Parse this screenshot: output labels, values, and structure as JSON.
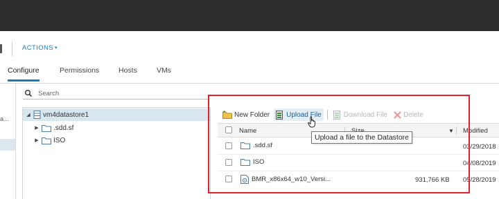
{
  "header": {
    "actions_label": "ACTIONS",
    "actions_chevron": "▾"
  },
  "tabs": [
    {
      "label": "Configure",
      "active": true
    },
    {
      "label": "Permissions",
      "active": false
    },
    {
      "label": "Hosts",
      "active": false
    },
    {
      "label": "VMs",
      "active": false
    }
  ],
  "left_pane": {
    "truncated_label": "a..."
  },
  "search": {
    "placeholder": "Search",
    "value": ""
  },
  "tree": {
    "items": [
      {
        "label": "vm4datastore1",
        "expanded": true,
        "selected": true,
        "icon": "datastore-icon"
      },
      {
        "label": ".sdd.sf",
        "expanded": false,
        "icon": "folder-icon"
      },
      {
        "label": "ISO",
        "expanded": false,
        "icon": "folder-icon"
      }
    ]
  },
  "toolbar": {
    "new_folder": "New Folder",
    "upload_file": "Upload File",
    "download_file": "Download File",
    "delete": "Delete"
  },
  "grid": {
    "columns": {
      "name": "Name",
      "size": "Size",
      "modified": "Modified"
    },
    "rows": [
      {
        "name": ".sdd.sf",
        "size": "",
        "modified": "03/29/2018",
        "icon": "folder-icon"
      },
      {
        "name": "ISO",
        "size": "",
        "modified": "04/08/2019",
        "icon": "folder-icon"
      },
      {
        "name": "BMR_x86x64_w10_Versi...",
        "size": "931,766 KB",
        "modified": "05/28/2019",
        "icon": "file-icon"
      }
    ]
  },
  "tooltip": {
    "text": "Upload a file to the Datastore"
  },
  "colors": {
    "accent": "#1b7cc1",
    "topbar": "#2e2e2e",
    "highlight_box": "#e0202a"
  }
}
